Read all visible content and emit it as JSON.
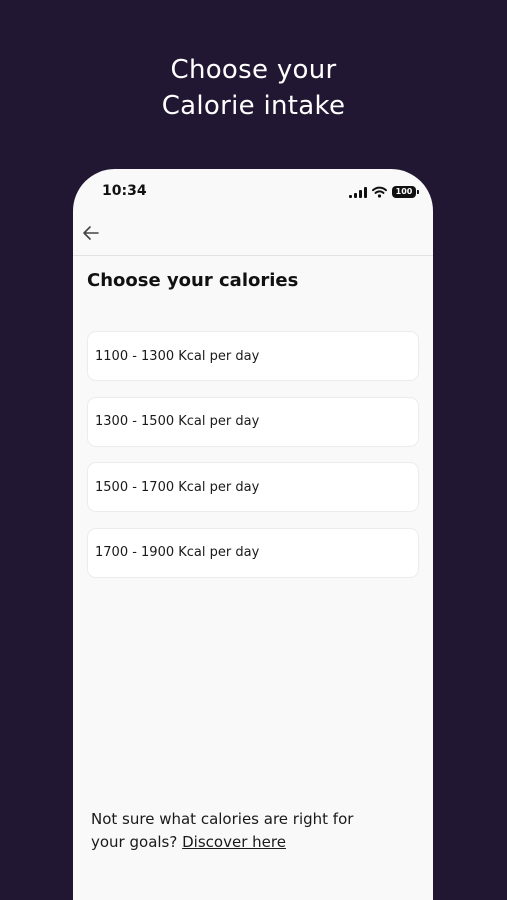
{
  "headline": {
    "line1": "Choose your",
    "line2": "Calorie intake"
  },
  "status_bar": {
    "time": "10:34",
    "battery": "100",
    "icons": [
      "signal-icon",
      "wifi-icon",
      "battery-icon"
    ]
  },
  "nav": {
    "back_icon": "arrow-left-icon"
  },
  "screen": {
    "title": "Choose your calories",
    "options": [
      "1100 - 1300 Kcal per day",
      "1300 - 1500 Kcal per day",
      "1500 - 1700 Kcal per day",
      "1700 - 1900 Kcal per day"
    ]
  },
  "footer": {
    "text": "Not sure what calories are right for your goals?",
    "link": "Discover here"
  },
  "colors": {
    "background": "#221733",
    "phone_screen": "#f9f9f9",
    "card": "#ffffff",
    "text": "#1a1a1a"
  }
}
